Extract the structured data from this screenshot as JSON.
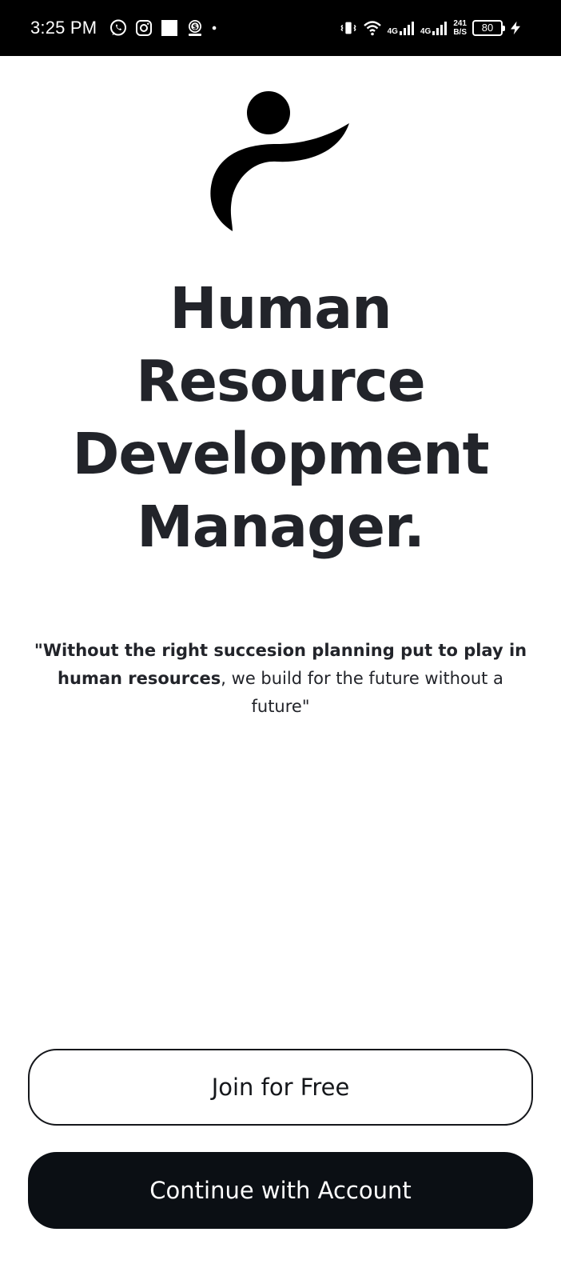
{
  "status_bar": {
    "time": "3:25 PM",
    "left_icons": [
      "whatsapp-icon",
      "instagram-icon",
      "square-icon",
      "money-icon",
      "dot-icon"
    ],
    "right_icons": [
      "vibrate-icon",
      "wifi-icon",
      "signal-icon",
      "signal-icon",
      "battery-icon",
      "charging-icon"
    ],
    "network_1": "4G",
    "network_2": "4G",
    "speed_value": "241",
    "speed_unit": "B/S",
    "battery": "80"
  },
  "welcome": {
    "logo": "person-logo",
    "title_lines": [
      "Human",
      "Resource",
      "Development",
      "Manager."
    ],
    "quote_bold": "\"Without the right succesion planning put to play in human resources",
    "quote_rest": ", we build for the future without a future\""
  },
  "actions": {
    "join_label": "Join for Free",
    "continue_label": "Continue with Account"
  },
  "colors": {
    "primary_dark": "#0b0f14",
    "text": "#22242a",
    "background": "#ffffff"
  }
}
